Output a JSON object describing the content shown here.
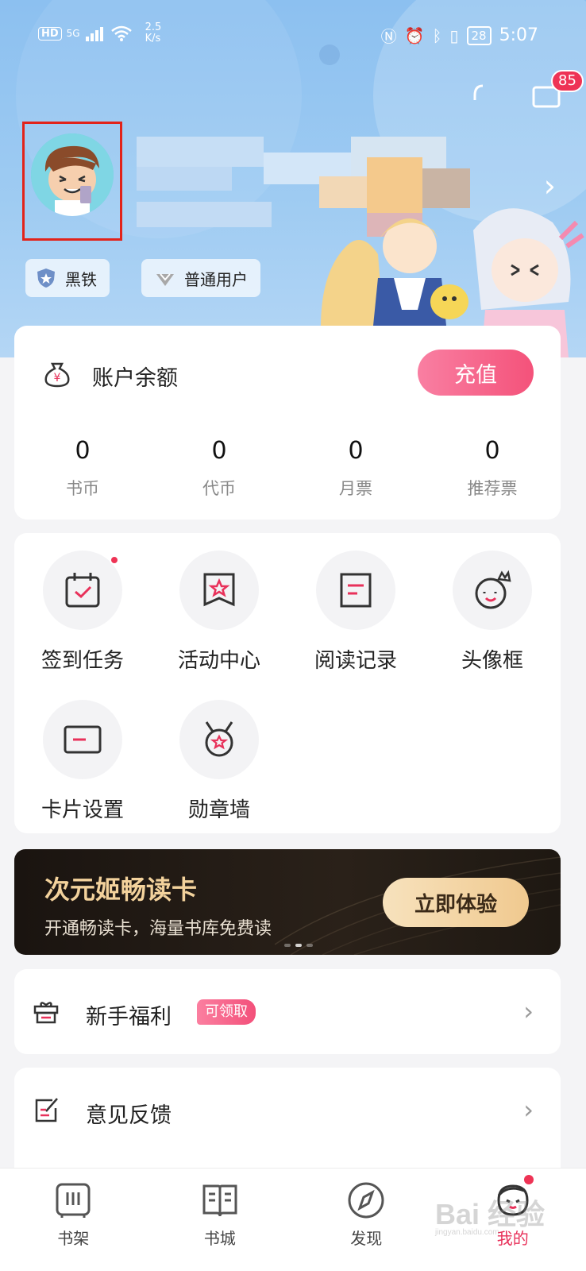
{
  "status_bar": {
    "hd": "HD",
    "network": "5G",
    "speed_value": "2.5",
    "speed_unit": "K/s",
    "battery": "28",
    "time": "5:07"
  },
  "header": {
    "message_count": "85"
  },
  "profile": {
    "level_badge": "黑铁",
    "user_type_badge": "普通用户"
  },
  "balance": {
    "title": "账户余额",
    "recharge_label": "充值",
    "stats": [
      {
        "value": "0",
        "label": "书币"
      },
      {
        "value": "0",
        "label": "代币"
      },
      {
        "value": "0",
        "label": "月票"
      },
      {
        "value": "0",
        "label": "推荐票"
      }
    ]
  },
  "features": [
    {
      "label": "签到任务",
      "icon": "calendar-check-icon",
      "has_dot": true
    },
    {
      "label": "活动中心",
      "icon": "star-ribbon-icon",
      "has_dot": false
    },
    {
      "label": "阅读记录",
      "icon": "document-icon",
      "has_dot": false
    },
    {
      "label": "头像框",
      "icon": "crown-face-icon",
      "has_dot": false
    },
    {
      "label": "卡片设置",
      "icon": "card-icon",
      "has_dot": false
    },
    {
      "label": "勋章墙",
      "icon": "medal-icon",
      "has_dot": false
    }
  ],
  "banner": {
    "title": "次元姬畅读卡",
    "subtitle": "开通畅读卡，海量书库免费读",
    "button": "立即体验"
  },
  "list": {
    "welfare_label": "新手福利",
    "welfare_tag": "可领取",
    "feedback_label": "意见反馈"
  },
  "tabs": [
    {
      "label": "书架",
      "icon": "bookshelf-icon",
      "active": false
    },
    {
      "label": "书城",
      "icon": "book-icon",
      "active": false
    },
    {
      "label": "发现",
      "icon": "compass-icon",
      "active": false
    },
    {
      "label": "我的",
      "icon": "mascot-face-icon",
      "active": true
    }
  ],
  "watermark": {
    "text": "Bai 经验",
    "url": "jingyan.baidu.com"
  },
  "colors": {
    "accent": "#f4527a",
    "hero_blue": "#9ecbf2",
    "banner_gold": "#f3d29c"
  }
}
